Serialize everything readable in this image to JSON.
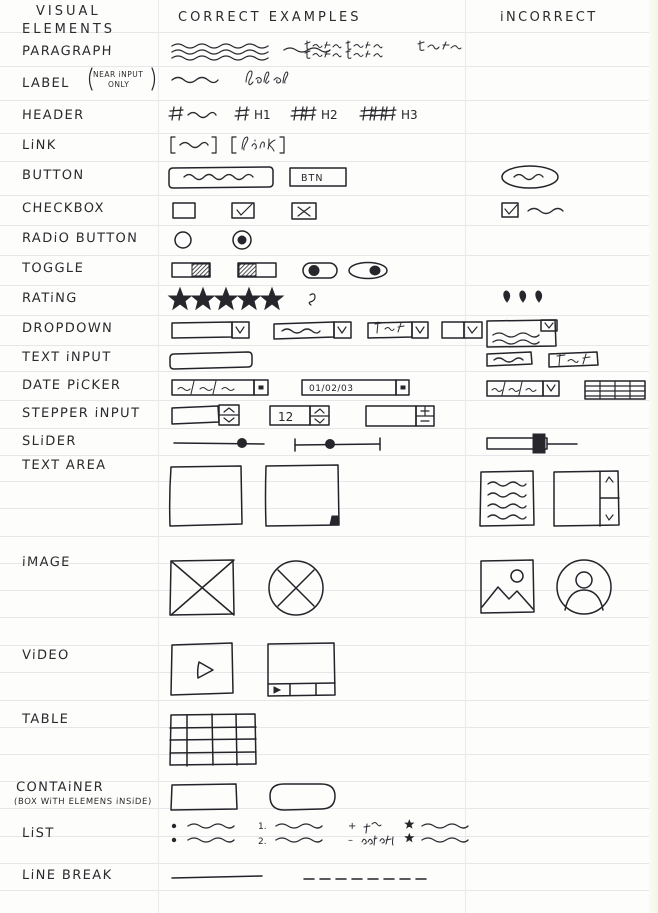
{
  "sheet": {
    "title_line_1": "VISUAL",
    "title_line_2": "ELEMENTS",
    "column_correct": "CORRECT EXAMPLES",
    "column_incorrect": "iNCORRECT",
    "paper_color": "#fdfdfb",
    "rule_color": "#e6e7e9",
    "ink_color": "#23232a"
  },
  "rows": [
    {
      "label": "PARAGRAPH",
      "note": "",
      "correct_notes": [
        "squiggle-lines-block",
        "short-squiggle",
        "text text text / text text text",
        "Text Text"
      ],
      "incorrect_notes": []
    },
    {
      "label": "LABEL",
      "note_paren_line_1": "NEAR iNPUT",
      "note_paren_line_2": "ONLY",
      "correct_notes": [
        "short-squiggle",
        "label"
      ],
      "incorrect_notes": []
    },
    {
      "label": "HEADER",
      "correct_notes": [
        "#",
        "# H1",
        "## H2",
        "### H3"
      ],
      "hash_1": "#",
      "h1": "H1",
      "h2": "H2",
      "h3": "H3",
      "incorrect_notes": []
    },
    {
      "label": "LiNK",
      "correct_notes": [
        "[ squiggle ]",
        "[ link ]"
      ],
      "link_text": "link",
      "incorrect_notes": []
    },
    {
      "label": "BUTTON",
      "correct_notes": [
        "rounded-rect-with-squiggle",
        "BTN"
      ],
      "btn_text": "BTN",
      "incorrect_notes": [
        "ellipse-with-squiggle"
      ]
    },
    {
      "label": "CHECKBOX",
      "correct_notes": [
        "empty-box",
        "checked-box",
        "crossed-box"
      ],
      "incorrect_notes": [
        "checked-box-with-squiggle-label"
      ]
    },
    {
      "label": "RADiO BUTTON",
      "correct_notes": [
        "empty-circle",
        "filled-circle"
      ],
      "incorrect_notes": []
    },
    {
      "label": "TOGGLE",
      "correct_notes": [
        "toggle-off-hatched-right",
        "toggle-on-hatched-left",
        "pill-knob-left",
        "ellipse-knob-right"
      ],
      "incorrect_notes": []
    },
    {
      "label": "RATiNG",
      "correct_notes": [
        "five-filled-stars",
        "half-mark"
      ],
      "incorrect_notes": [
        "three-hearts"
      ]
    },
    {
      "label": "DROPDOWN",
      "correct_notes": [
        "empty-select-caret",
        "squiggle-select-caret",
        "Text select caret",
        "small-select-caret"
      ],
      "select_text": "Text",
      "incorrect_notes": [
        "open-dropdown-with-options"
      ]
    },
    {
      "label": "TEXT iNPUT",
      "correct_notes": [
        "empty-rounded-rect"
      ],
      "incorrect_notes": [
        "squiggle-filled-field",
        "Text field"
      ],
      "incorrect_text": "Text"
    },
    {
      "label": "DATE PiCKER",
      "correct_notes": [
        "__/__/__ with button",
        "01/02/03 with button"
      ],
      "date_placeholder": "__/__/__",
      "date_value": "01/02/03",
      "incorrect_notes": [
        "date-with-caret-select",
        "calendar-grid"
      ]
    },
    {
      "label": "STEPPER iNPUT",
      "correct_notes": [
        "empty-stepper-up-down",
        "12 stepper",
        "plus-minus-stepper"
      ],
      "stepper_value": "12",
      "plus": "+",
      "minus": "–",
      "incorrect_notes": []
    },
    {
      "label": "SLiDER",
      "correct_notes": [
        "line-with-knob",
        "line-with-end-caps-and-knob"
      ],
      "incorrect_notes": [
        "bar-with-block-handle"
      ]
    },
    {
      "label": "TEXT AREA",
      "correct_notes": [
        "empty-square",
        "square-with-corner-grip"
      ],
      "incorrect_notes": [
        "box-with-text-lines",
        "box-with-scrollbar"
      ]
    },
    {
      "label": "iMAGE",
      "correct_notes": [
        "square-with-x",
        "circle-with-x"
      ],
      "incorrect_notes": [
        "photo-mountain-icon",
        "avatar-person-circle"
      ]
    },
    {
      "label": "ViDEO",
      "correct_notes": [
        "square-with-play-triangle",
        "square-with-control-bar"
      ],
      "incorrect_notes": []
    },
    {
      "label": "TABLE",
      "correct_notes": [
        "grid-4x4"
      ],
      "incorrect_notes": []
    },
    {
      "label": "CONTAiNER",
      "note_line_2": "(BOX WiTH ELEMENS iNSiDE)",
      "correct_notes": [
        "rectangle",
        "rounded-rectangle"
      ],
      "incorrect_notes": []
    },
    {
      "label": "LiST",
      "correct_notes": [
        "bulleted-list",
        "numbered-list",
        "plus-minus-nested-list",
        "star-bullet-list"
      ],
      "num_1": "1.",
      "num_2": "2.",
      "plus": "+",
      "minus": "–",
      "sub_text": "subtext",
      "incorrect_notes": []
    },
    {
      "label": "LiNE BREAK",
      "correct_notes": [
        "solid-rule",
        "dashed-rule"
      ],
      "incorrect_notes": []
    }
  ]
}
